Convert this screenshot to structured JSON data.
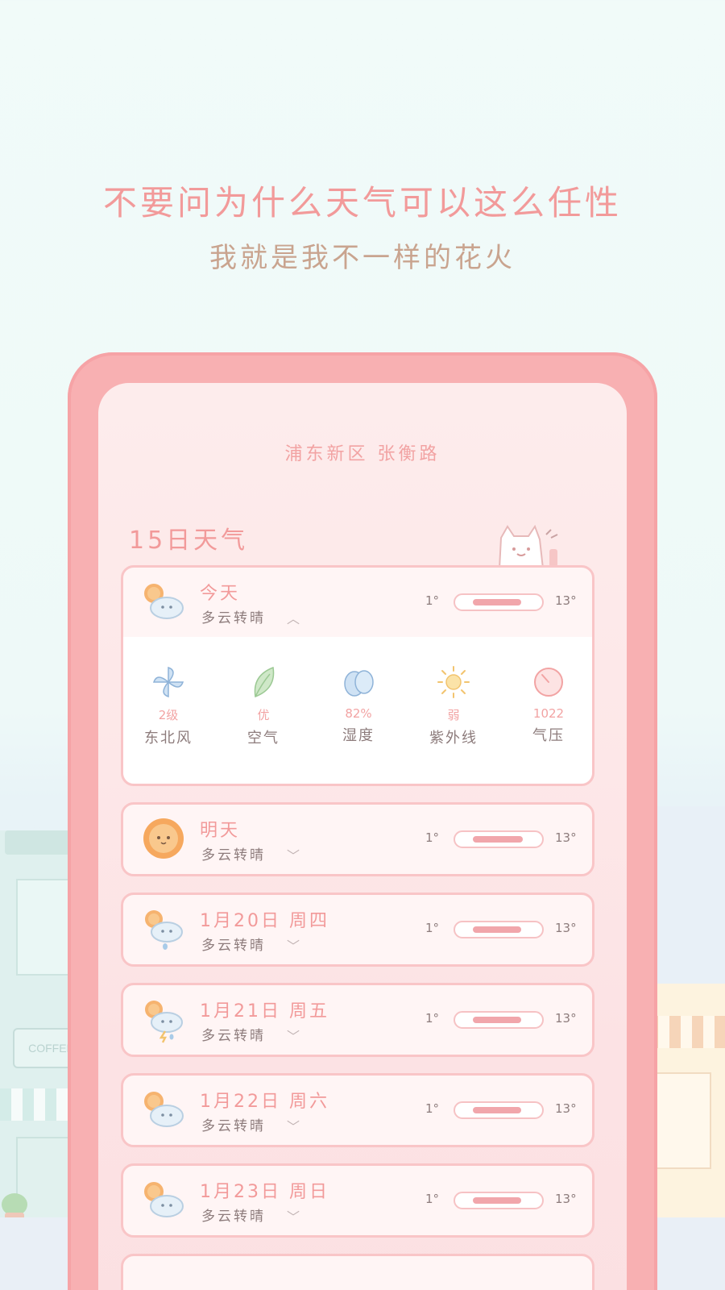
{
  "headline": {
    "line1": "不要问为什么天气可以这么任性",
    "line2": "我就是我不一样的花火"
  },
  "background": {
    "shop_sign": "COFFEE"
  },
  "location": "浦东新区 张衡路",
  "section_title": "15日天气",
  "colors": {
    "accent": "#f29a9a",
    "frame": "#f8b0b2",
    "card_border": "#f9c5c7",
    "bar_fill": "#f1a6ab",
    "text": "#8d7c7c"
  },
  "days": [
    {
      "date": "今天",
      "condition": "多云转晴",
      "low": "1°",
      "high": "13°",
      "expanded": true,
      "icon": "sun-cloud-icon"
    },
    {
      "date": "明天",
      "condition": "多云转晴",
      "low": "1°",
      "high": "13°",
      "expanded": false,
      "icon": "sun-icon"
    },
    {
      "date": "1月20日 周四",
      "condition": "多云转晴",
      "low": "1°",
      "high": "13°",
      "expanded": false,
      "icon": "sun-cloud-rain-icon"
    },
    {
      "date": "1月21日 周五",
      "condition": "多云转晴",
      "low": "1°",
      "high": "13°",
      "expanded": false,
      "icon": "sun-cloud-thunder-icon"
    },
    {
      "date": "1月22日 周六",
      "condition": "多云转晴",
      "low": "1°",
      "high": "13°",
      "expanded": false,
      "icon": "sun-cloud-icon"
    },
    {
      "date": "1月23日 周日",
      "condition": "多云转晴",
      "low": "1°",
      "high": "13°",
      "expanded": false,
      "icon": "sun-cloud-icon"
    }
  ],
  "today_details": [
    {
      "value": "2级",
      "label": "东北风",
      "icon": "pinwheel-icon"
    },
    {
      "value": "优",
      "label": "空气",
      "icon": "leaf-icon"
    },
    {
      "value": "82%",
      "label": "湿度",
      "icon": "water-drops-icon"
    },
    {
      "value": "弱",
      "label": "紫外线",
      "icon": "sun-rays-icon"
    },
    {
      "value": "1022",
      "label": "气压",
      "icon": "pressure-gauge-icon"
    }
  ]
}
